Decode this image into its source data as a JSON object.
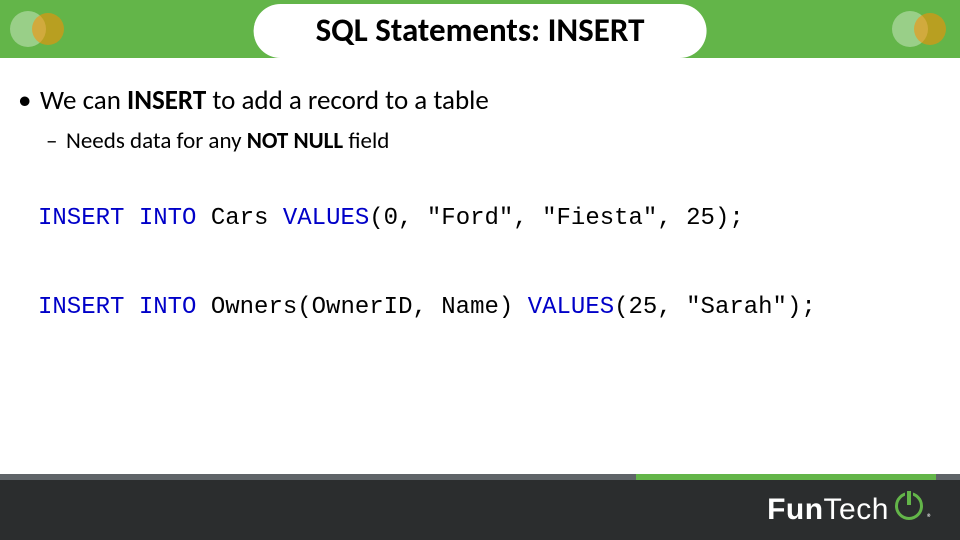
{
  "title": "SQL Statements: INSERT",
  "bullets": {
    "l1_pre": "We can ",
    "l1_strong": "INSERT",
    "l1_post": " to add a record to a table",
    "l2_pre": "Needs data for any ",
    "l2_strong": "NOT NULL",
    "l2_post": " field"
  },
  "code": {
    "line1_kw": "INSERT INTO",
    "line1_mid": " Cars ",
    "line1_kw2": "VALUES",
    "line1_rest": "(0, \"Ford\", \"Fiesta\", 25);",
    "line2_kw": "INSERT INTO",
    "line2_mid": " Owners(OwnerID, Name) ",
    "line2_kw2": "VALUES",
    "line2_rest": "(25, \"Sarah\");"
  },
  "brand": {
    "fun": "Fun",
    "tech": "Tech",
    "reg": "®"
  },
  "colors": {
    "green": "#63b549",
    "darkgrey": "#2b2d2e",
    "midgrey": "#5f6468",
    "code_kw": "#0000c8"
  }
}
